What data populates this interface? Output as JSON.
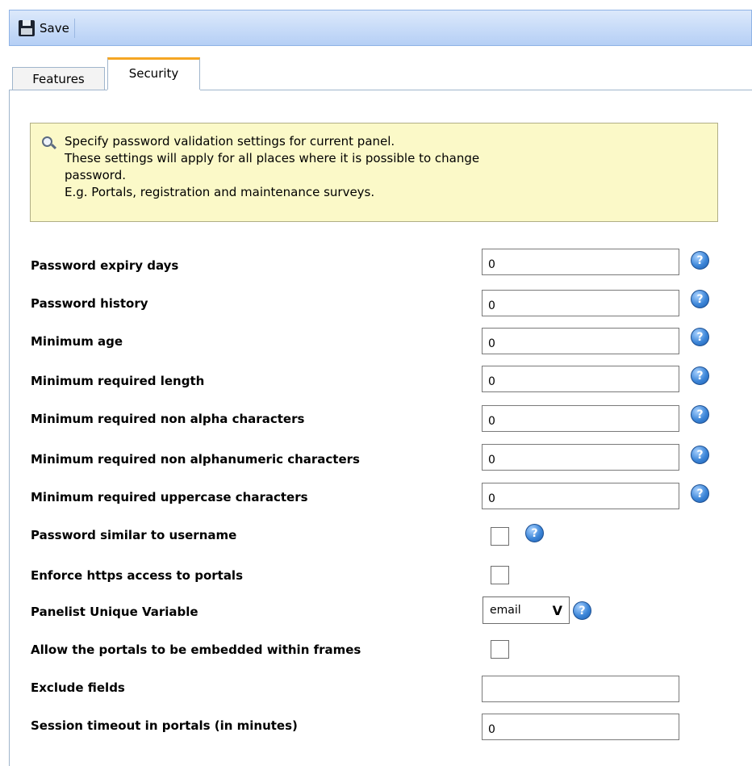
{
  "toolbar": {
    "save_label": "Save",
    "save_icon": "floppy-disk-icon"
  },
  "tabs": [
    {
      "label": "Features",
      "active": false
    },
    {
      "label": "Security",
      "active": true
    }
  ],
  "info": {
    "icon": "info-magnifier-icon",
    "text": "Specify password validation settings for current panel.\nThese settings will apply for all places where it is possible to change\npassword.\nE.g. Portals, registration and maintenance surveys."
  },
  "fields": {
    "password_expiry_days": {
      "label": "Password expiry days",
      "value": "0"
    },
    "password_history": {
      "label": "Password history",
      "value": "0"
    },
    "minimum_age": {
      "label": "Minimum age",
      "value": "0"
    },
    "minimum_required_length": {
      "label": "Minimum required length",
      "value": "0"
    },
    "min_non_alpha": {
      "label": "Minimum required non alpha characters",
      "value": "0"
    },
    "min_non_alphanumeric": {
      "label": "Minimum required non alphanumeric characters",
      "value": "0"
    },
    "min_uppercase": {
      "label": "Minimum required uppercase characters",
      "value": "0"
    },
    "password_similar_username": {
      "label": "Password similar to username",
      "checked": false
    },
    "enforce_https": {
      "label": "Enforce https access to portals",
      "checked": false
    },
    "panelist_unique_variable": {
      "label": "Panelist Unique Variable",
      "value": "email"
    },
    "allow_embedded_frames": {
      "label": "Allow the portals to be embedded within frames",
      "checked": false
    },
    "exclude_fields": {
      "label": "Exclude fields",
      "value": ""
    },
    "session_timeout": {
      "label": "Session timeout in portals (in minutes)",
      "value": "0"
    }
  },
  "help_icon": {
    "glyph": "?"
  },
  "colors": {
    "tab_accent": "#f5a623",
    "info_bg": "#fbf9c8",
    "toolbar_blue": "#b5cff5"
  }
}
